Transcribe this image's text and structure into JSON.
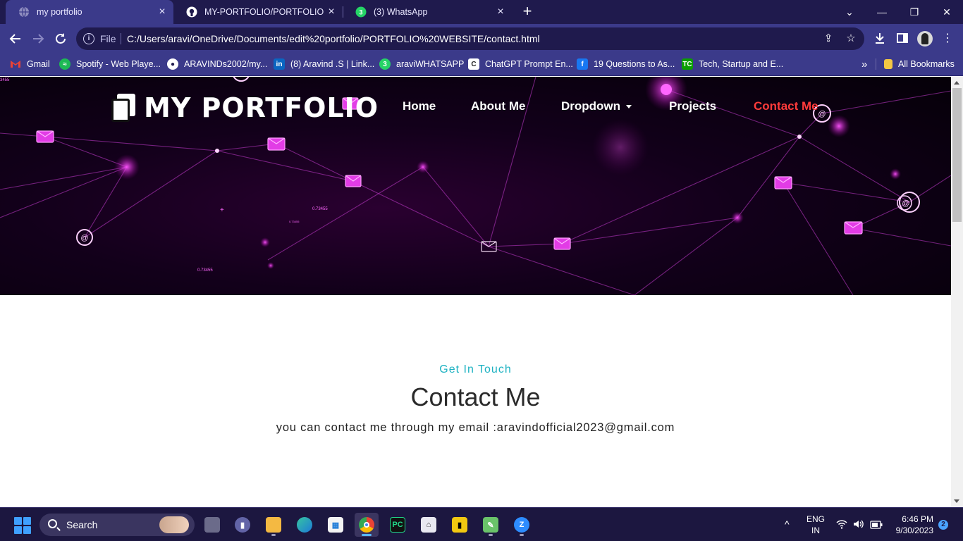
{
  "browser": {
    "tabs": [
      {
        "title": "my portfolio",
        "active": true
      },
      {
        "title": "MY-PORTFOLIO/PORTFOLIO WE",
        "active": false
      },
      {
        "title": "(3) WhatsApp",
        "active": false
      }
    ],
    "new_tab": "+",
    "window_controls": {
      "minimize": "—",
      "restore": "❐",
      "close": "✕",
      "tab_search": "⌄"
    },
    "address": {
      "scheme_label": "File",
      "url": "C:/Users/aravi/OneDrive/Documents/edit%20portfolio/PORTFOLIO%20WEBSITE/contact.html"
    },
    "bookmarks": [
      {
        "label": "Gmail",
        "icon": "gmail-icon"
      },
      {
        "label": "Spotify - Web Playe...",
        "icon": "spotify-icon"
      },
      {
        "label": "ARAVINDs2002/my...",
        "icon": "github-icon"
      },
      {
        "label": "(8) Aravind .S | Link...",
        "icon": "linkedin-icon"
      },
      {
        "label": "araviWHATSAPP",
        "icon": "whatsapp-icon"
      },
      {
        "label": "ChatGPT Prompt En...",
        "icon": "chatgpt-icon"
      },
      {
        "label": "19 Questions to As...",
        "icon": "facebook-icon"
      },
      {
        "label": "Tech, Startup and E...",
        "icon": "techcrunch-icon"
      }
    ],
    "bookmarks_overflow": "»",
    "all_bookmarks": "All Bookmarks"
  },
  "site": {
    "brand": "MY PORTFOLIO",
    "nav": [
      {
        "label": "Home",
        "active": false
      },
      {
        "label": "About Me",
        "active": false
      },
      {
        "label": "Dropdown",
        "active": false
      },
      {
        "label": "Projects",
        "active": false
      },
      {
        "label": "Contact Me",
        "active": true
      }
    ],
    "hero_labels": [
      "0.73455",
      "0.73455",
      "0.73455",
      "3455"
    ],
    "contact": {
      "eyebrow": "Get In Touch",
      "heading": "Contact Me",
      "lead": "you can contact me through my email :aravindofficial2023@gmail.com"
    }
  },
  "taskbar": {
    "search": "Search",
    "language": {
      "line1": "ENG",
      "line2": "IN"
    },
    "time": "6:46 PM",
    "date": "9/30/2023",
    "notification_count": "2"
  },
  "colors": {
    "accent": "#1eb2c2",
    "active_nav": "#ff3b3b",
    "hero_glow": "#ff33ff",
    "chrome": "#3b3a8a"
  }
}
